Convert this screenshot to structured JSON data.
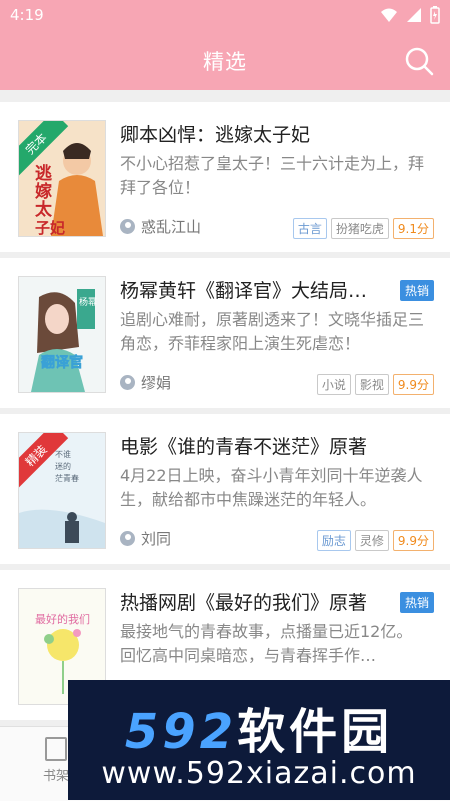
{
  "status": {
    "time": "4:19"
  },
  "appbar": {
    "title": "精选"
  },
  "books": [
    {
      "title": "卿本凶悍：逃嫁太子妃",
      "desc": "不小心招惹了皇太子！三十六计走为上，拜拜了各位！",
      "author": "惑乱江山",
      "tags": [
        "古言",
        "扮猪吃虎"
      ],
      "score": "9.1分",
      "badge": "",
      "cover_ribbon": "完本",
      "cover_text": "逃嫁太子妃"
    },
    {
      "title": "杨幂黄轩《翻译官》大结局…",
      "desc": "追剧心难耐，原著剧透来了！文晓华插足三角恋，乔菲程家阳上演生死虐恋！",
      "author": "缪娟",
      "tags": [
        "小说",
        "影视"
      ],
      "score": "9.9分",
      "badge": "热销",
      "cover_ribbon": "",
      "cover_text": "翻译官"
    },
    {
      "title": "电影《谁的青春不迷茫》原著",
      "desc": "4月22日上映，奋斗小青年刘同十年逆袭人生，献给都市中焦躁迷茫的年轻人。",
      "author": "刘同",
      "tags": [
        "励志",
        "灵修"
      ],
      "score": "9.9分",
      "badge": "",
      "cover_ribbon": "精装",
      "cover_text": "不谁迷的茫青春"
    },
    {
      "title": "热播网剧《最好的我们》原著",
      "desc": "最接地气的青春故事，点播量已近12亿。回忆高中同桌暗恋，与青春挥手作…",
      "author": "",
      "tags": [],
      "score": "",
      "badge": "热销",
      "cover_ribbon": "",
      "cover_text": "最好的我们"
    }
  ],
  "nav": {
    "bookshelf_label": "书架"
  },
  "watermark": {
    "logo_num": "592",
    "logo_cn": "软件园",
    "url": "www.592xiazai.com"
  },
  "colors": {
    "appbar": "#f7a6b4",
    "badge": "#3b8fe0",
    "score": "#f08a1c"
  }
}
